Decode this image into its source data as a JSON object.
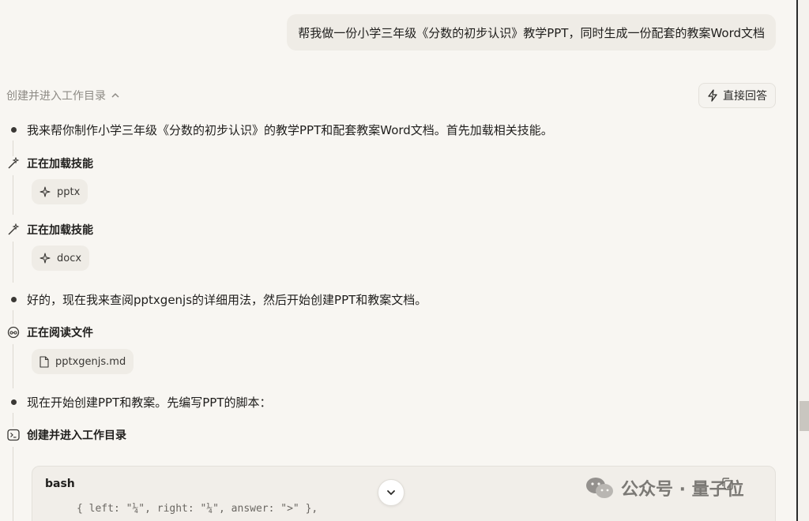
{
  "user_message": "帮我做一份小学三年级《分数的初步认识》教学PPT，同时生成一份配套的教案Word文档",
  "task_header": {
    "label": "创建并进入工作目录"
  },
  "direct_answer_label": "直接回答",
  "steps": {
    "intro": "我来帮你制作小学三年级《分数的初步认识》的教学PPT和配套教案Word文档。首先加载相关技能。",
    "load1": {
      "title": "正在加载技能",
      "chip": "pptx"
    },
    "load2": {
      "title": "正在加载技能",
      "chip": "docx"
    },
    "msg2": "好的，现在我来查阅pptxgenjs的详细用法，然后开始创建PPT和教案文档。",
    "read": {
      "title": "正在阅读文件",
      "chip": "pptxgenjs.md"
    },
    "msg3": "现在开始创建PPT和教案。先编写PPT的脚本：",
    "cmd": {
      "title": "创建并进入工作目录"
    }
  },
  "code": {
    "lang": "bash",
    "line": "{ left: \"¼\", right: \"¼\", answer: \">\" },"
  },
  "watermark": {
    "text": "公众号 · 量子位"
  }
}
